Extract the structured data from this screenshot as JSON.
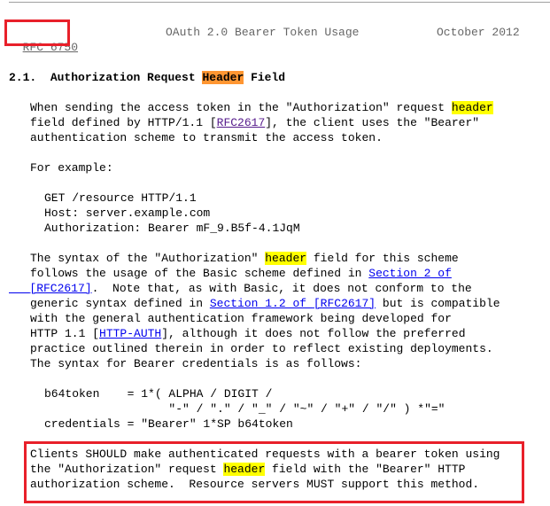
{
  "page_header": {
    "rfc_link": "RFC 6750",
    "doc_title": "OAuth 2.0 Bearer Token Usage",
    "date": "October 2012"
  },
  "section": {
    "number": "2.1.",
    "title_before": "Authorization Request ",
    "title_highlight": "Header",
    "title_after": " Field"
  },
  "para1": {
    "l1_before": "When sending the access token in the \"Authorization\" request ",
    "l1_highlight": "header",
    "l2_before": "field defined by HTTP/1.1 [",
    "l2_link": "RFC2617",
    "l2_after": "], the client uses the \"Bearer\"",
    "l3": "authentication scheme to transmit the access token."
  },
  "example_intro": "For example:",
  "example": [
    "GET /resource HTTP/1.1",
    "Host: server.example.com",
    "Authorization: Bearer mF_9.B5f-4.1JqM"
  ],
  "para2": {
    "l1_before": "The syntax of the \"Authorization\" ",
    "l1_highlight": "header",
    "l1_after": " field for this scheme",
    "l2_before": "follows the usage of the Basic scheme defined in ",
    "l2_link": "Section 2 of",
    "l3_link": "[RFC2617]",
    "l3_after": ".  Note that, as with Basic, it does not conform to the",
    "l4_before": "generic syntax defined in ",
    "l4_link1": "Section 1.2 of ",
    "l4_link2": "[RFC2617]",
    "l4_after": " but is compatible",
    "l5": "with the general authentication framework being developed for",
    "l6_before": "HTTP 1.1 [",
    "l6_link": "HTTP-AUTH",
    "l6_after": "], although it does not follow the preferred",
    "l7": "practice outlined therein in order to reflect existing deployments.",
    "l8": "The syntax for Bearer credentials is as follows:"
  },
  "abnf": [
    "b64token    = 1*( ALPHA / DIGIT /",
    "                  \"-\" / \".\" / \"_\" / \"~\" / \"+\" / \"/\" ) *\"=\"",
    "credentials = \"Bearer\" 1*SP b64token"
  ],
  "para3": {
    "l1": "Clients SHOULD make authenticated requests with a bearer token using",
    "l2_before": "the \"Authorization\" request ",
    "l2_highlight": "header",
    "l2_after": " field with the \"Bearer\" HTTP",
    "l3": "authorization scheme.  Resource servers MUST support this method."
  },
  "colors": {
    "annotation_box": "#e8202a",
    "highlight_current": "#ff9632",
    "highlight_match": "#ffff00",
    "link": "#0000ee",
    "visited_link": "#551a8b"
  }
}
